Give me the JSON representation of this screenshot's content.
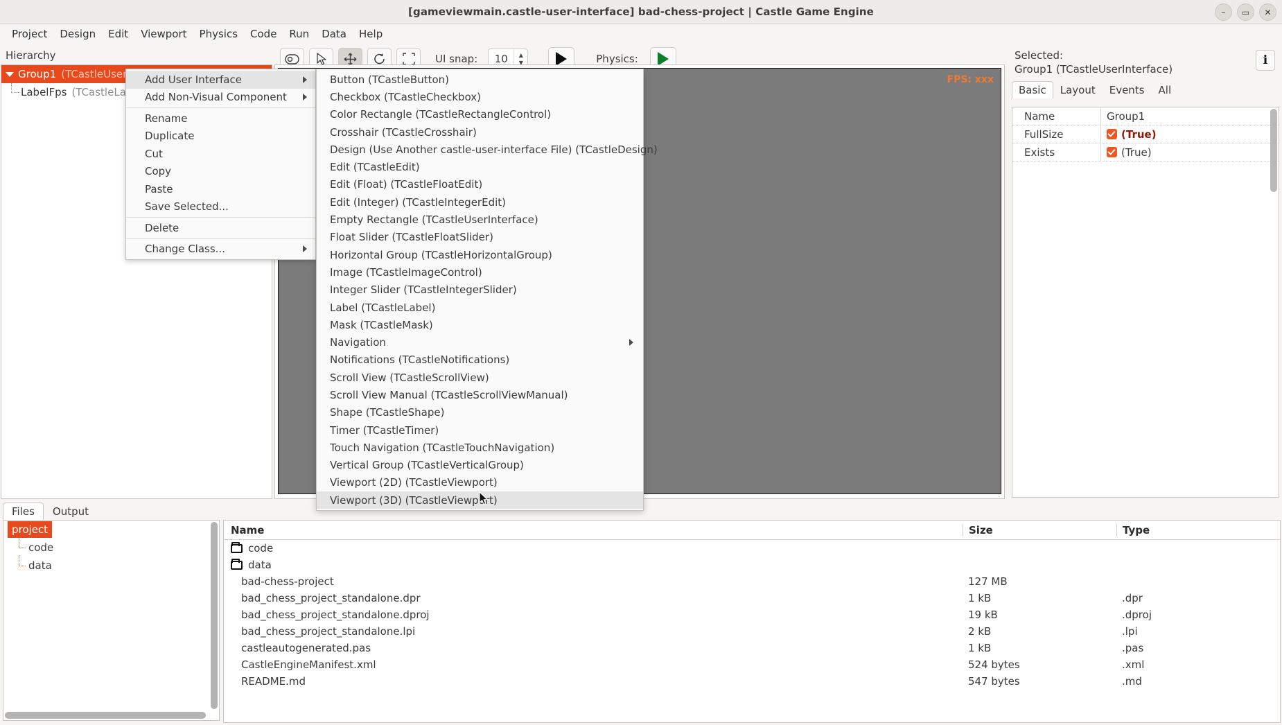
{
  "window": {
    "title": "[gameviewmain.castle-user-interface] bad-chess-project | Castle Game Engine",
    "minimize": "–",
    "maximize": "▭",
    "close": "✕"
  },
  "menubar": {
    "items": [
      "Project",
      "Design",
      "Edit",
      "Viewport",
      "Physics",
      "Code",
      "Run",
      "Data",
      "Help"
    ]
  },
  "hierarchy": {
    "label": "Hierarchy",
    "nodes": [
      {
        "name": "Group1",
        "class": "(TCastleUserInterface)",
        "selected": true
      },
      {
        "name": "LabelFps",
        "class": "(TCastleLab",
        "selected": false
      }
    ]
  },
  "toolbar": {
    "uisnap_label": "UI snap:",
    "uisnap_value": "10",
    "physics_label": "Physics:",
    "buttons": [
      {
        "name": "toggle-eye",
        "glyph": "◎"
      },
      {
        "name": "select-arrow",
        "glyph": "↖"
      },
      {
        "name": "translate",
        "glyph": "✥"
      },
      {
        "name": "rotate",
        "glyph": "↻"
      },
      {
        "name": "scale",
        "glyph": "⤡"
      }
    ]
  },
  "canvas": {
    "fps": "FPS: xxx"
  },
  "properties": {
    "selected_prefix": "Selected:",
    "selected_object": "Group1 (TCastleUserInterface)",
    "info_glyph": "i",
    "tabs": [
      "Basic",
      "Layout",
      "Events",
      "All"
    ],
    "active_tab": "Basic",
    "rows": [
      {
        "name": "Exists",
        "value": "(True)",
        "checkbox": true,
        "modified": false
      },
      {
        "name": "FullSize",
        "value": "(True)",
        "checkbox": true,
        "modified": true
      },
      {
        "name": "Name",
        "value": "Group1",
        "checkbox": false,
        "modified": false
      }
    ]
  },
  "bottom": {
    "tabs": [
      "Files",
      "Output"
    ],
    "active_tab": "Files",
    "project_tree": [
      {
        "label": "project",
        "selected": true,
        "indent": false
      },
      {
        "label": "code",
        "selected": false,
        "indent": true
      },
      {
        "label": "data",
        "selected": false,
        "indent": true
      }
    ],
    "columns": [
      "Name",
      "Size",
      "Type"
    ],
    "files": [
      {
        "name": "code",
        "size": "",
        "type": "",
        "folder": true
      },
      {
        "name": "data",
        "size": "",
        "type": "",
        "folder": true
      },
      {
        "name": "bad-chess-project",
        "size": "127 MB",
        "type": "",
        "folder": false
      },
      {
        "name": "bad_chess_project_standalone.dpr",
        "size": "1 kB",
        "type": ".dpr",
        "folder": false
      },
      {
        "name": "bad_chess_project_standalone.dproj",
        "size": "19 kB",
        "type": ".dproj",
        "folder": false
      },
      {
        "name": "bad_chess_project_standalone.lpi",
        "size": "2 kB",
        "type": ".lpi",
        "folder": false
      },
      {
        "name": "castleautogenerated.pas",
        "size": "1 kB",
        "type": ".pas",
        "folder": false
      },
      {
        "name": "CastleEngineManifest.xml",
        "size": "524 bytes",
        "type": ".xml",
        "folder": false
      },
      {
        "name": "README.md",
        "size": "547 bytes",
        "type": ".md",
        "folder": false
      }
    ]
  },
  "context_menu": {
    "items": [
      {
        "label": "Add User Interface",
        "submenu": true,
        "highlight": true,
        "separator_after": false
      },
      {
        "label": "Add Non-Visual Component",
        "submenu": true,
        "highlight": false,
        "separator_after": true
      },
      {
        "label": "Rename",
        "submenu": false,
        "highlight": false,
        "separator_after": false
      },
      {
        "label": "Duplicate",
        "submenu": false,
        "highlight": false,
        "separator_after": false
      },
      {
        "label": "Cut",
        "submenu": false,
        "highlight": false,
        "separator_after": false
      },
      {
        "label": "Copy",
        "submenu": false,
        "highlight": false,
        "separator_after": false
      },
      {
        "label": "Paste",
        "submenu": false,
        "highlight": false,
        "separator_after": false
      },
      {
        "label": "Save Selected...",
        "submenu": false,
        "highlight": false,
        "separator_after": true
      },
      {
        "label": "Delete",
        "submenu": false,
        "highlight": false,
        "separator_after": true
      },
      {
        "label": "Change Class...",
        "submenu": true,
        "highlight": false,
        "separator_after": false
      }
    ]
  },
  "submenu": {
    "items": [
      {
        "label": "Button (TCastleButton)",
        "submenu": false,
        "highlight": false
      },
      {
        "label": "Checkbox (TCastleCheckbox)",
        "submenu": false,
        "highlight": false
      },
      {
        "label": "Color Rectangle (TCastleRectangleControl)",
        "submenu": false,
        "highlight": false
      },
      {
        "label": "Crosshair (TCastleCrosshair)",
        "submenu": false,
        "highlight": false
      },
      {
        "label": "Design (Use Another castle-user-interface File) (TCastleDesign)",
        "submenu": false,
        "highlight": false
      },
      {
        "label": "Edit (TCastleEdit)",
        "submenu": false,
        "highlight": false
      },
      {
        "label": "Edit (Float) (TCastleFloatEdit)",
        "submenu": false,
        "highlight": false
      },
      {
        "label": "Edit (Integer) (TCastleIntegerEdit)",
        "submenu": false,
        "highlight": false
      },
      {
        "label": "Empty Rectangle (TCastleUserInterface)",
        "submenu": false,
        "highlight": false
      },
      {
        "label": "Float Slider (TCastleFloatSlider)",
        "submenu": false,
        "highlight": false
      },
      {
        "label": "Horizontal Group (TCastleHorizontalGroup)",
        "submenu": false,
        "highlight": false
      },
      {
        "label": "Image (TCastleImageControl)",
        "submenu": false,
        "highlight": false
      },
      {
        "label": "Integer Slider (TCastleIntegerSlider)",
        "submenu": false,
        "highlight": false
      },
      {
        "label": "Label (TCastleLabel)",
        "submenu": false,
        "highlight": false
      },
      {
        "label": "Mask (TCastleMask)",
        "submenu": false,
        "highlight": false
      },
      {
        "label": "Navigation",
        "submenu": true,
        "highlight": false
      },
      {
        "label": "Notifications (TCastleNotifications)",
        "submenu": false,
        "highlight": false
      },
      {
        "label": "Scroll View (TCastleScrollView)",
        "submenu": false,
        "highlight": false
      },
      {
        "label": "Scroll View Manual (TCastleScrollViewManual)",
        "submenu": false,
        "highlight": false
      },
      {
        "label": "Shape (TCastleShape)",
        "submenu": false,
        "highlight": false
      },
      {
        "label": "Timer (TCastleTimer)",
        "submenu": false,
        "highlight": false
      },
      {
        "label": "Touch Navigation (TCastleTouchNavigation)",
        "submenu": false,
        "highlight": false
      },
      {
        "label": "Vertical Group (TCastleVerticalGroup)",
        "submenu": false,
        "highlight": false
      },
      {
        "label": "Viewport (2D) (TCastleViewport)",
        "submenu": false,
        "highlight": false
      },
      {
        "label": "Viewport (3D) (TCastleViewport)",
        "submenu": false,
        "highlight": true
      }
    ]
  },
  "colors": {
    "accent": "#e8491c",
    "modified": "#8b1a06",
    "canvas": "#7b7b7b",
    "physics_green": "#0a8028"
  }
}
